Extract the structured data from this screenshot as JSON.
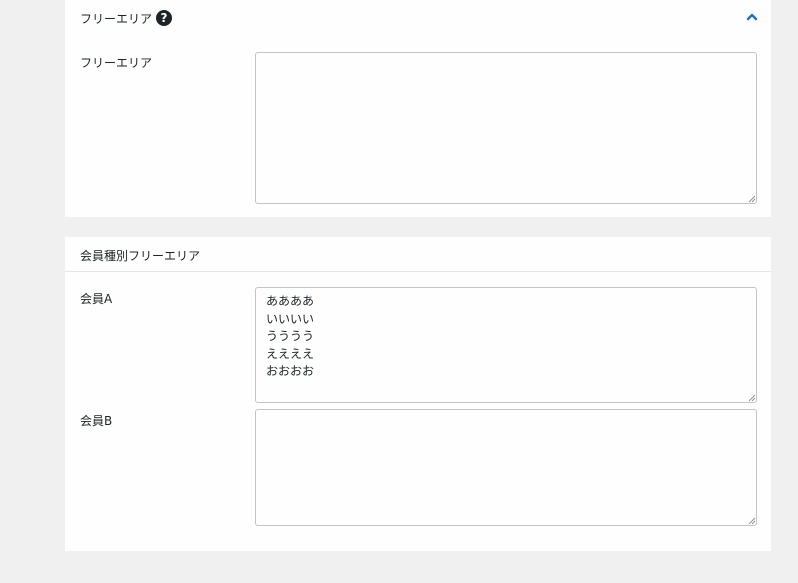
{
  "free_area_section": {
    "title": "フリーエリア",
    "help_icon_glyph": "?",
    "field_label": "フリーエリア",
    "field_value": ""
  },
  "member_section": {
    "title": "会員種別フリーエリア",
    "fields": [
      {
        "label": "会員A",
        "value": "ああああ\nいいいい\nうううう\nええええ\nおおおお"
      },
      {
        "label": "会員B",
        "value": ""
      }
    ]
  },
  "colors": {
    "page_background": "#f0f0f1",
    "panel_background": "#fdfefd",
    "border": "#c3c4c7",
    "accent": "#2271b1",
    "text": "#1d2327"
  },
  "icons": {
    "help": "question-circle-icon",
    "toggle": "chevron-up-icon",
    "resize": "resize-grip-icon"
  }
}
